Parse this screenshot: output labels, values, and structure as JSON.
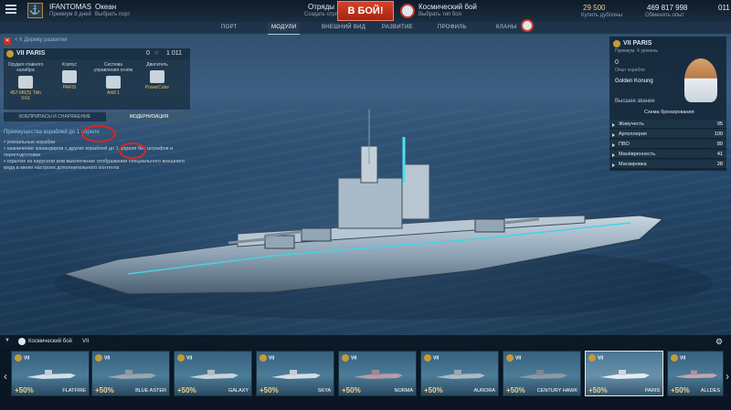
{
  "topbar": {
    "username": "IFANTOMAS",
    "user_sub": "Премиум 8 дней",
    "mode": "Океан",
    "mode_sub": "Выбрать порт",
    "squads": "Отряды",
    "squads_sub": "Создать отряд",
    "battle_button": "В БОЙ!",
    "battle_type": "Космический бой",
    "battle_type_sub": "Выбрать тип боя",
    "credits": "29 500",
    "credits_sub": "Купить дублоны",
    "silver": "469 817 998",
    "silver_sub": "Обменять опыт",
    "flags": "011"
  },
  "nav": {
    "tabs": [
      {
        "label": "ПОРТ",
        "active": false
      },
      {
        "label": "МОДУЛИ",
        "active": true
      },
      {
        "label": "ВНЕШНИЙ ВИД",
        "active": false
      },
      {
        "label": "РАЗВИТИЕ",
        "active": false
      },
      {
        "label": "ПРОФИЛЬ",
        "active": false
      },
      {
        "label": "КЛАНЫ",
        "active": false
      }
    ]
  },
  "left_panel": {
    "back_link": "< К Дереву развития",
    "ship_name": "VII PARIS",
    "ship_xp": "0",
    "ship_free": "1 011",
    "modules": [
      {
        "title": "Орудия главного калибра",
        "value": "457-МК(5) Tikh XXX"
      },
      {
        "title": "Корпус",
        "value": "PARIS"
      },
      {
        "title": "Система управления огнём",
        "value": "Аrtill 1"
      },
      {
        "title": "Двигатель",
        "value": "PowerCube"
      }
    ],
    "subtabs": [
      "БОЕПРИПАСЫ И СНАРЯЖЕНИЕ",
      "МОДЕРНИЗАЦИЯ"
    ],
    "notes_head": "Преимущества кораблей до 1 апреля",
    "notes": [
      "• уникальные корабли",
      "• назначение командиров с других кораблей до 1 апреля без штрафов и переподготовки",
      "• скрытие из карусели или выключение отображения специального внешнего вида в меню настроек дополнительного контента"
    ]
  },
  "right_panel": {
    "ship_name": "VII PARIS",
    "ship_sub": "Премиум. 4 уровень",
    "xp_value": "0",
    "xp_label": "Опыт корабля",
    "commander_name": "Golden Konung",
    "rank_label": "Высшее звание",
    "armor_label": "Схема бронирования",
    "stats": [
      {
        "label": "Живучесть",
        "value": "95"
      },
      {
        "label": "Артиллерия",
        "value": "100"
      },
      {
        "label": "ПВО",
        "value": "89"
      },
      {
        "label": "Манёвренность",
        "value": "41"
      },
      {
        "label": "Маскировка",
        "value": "28"
      }
    ]
  },
  "carousel": {
    "filter_label": "Космический бой",
    "tier_label": "VII",
    "ships": [
      {
        "tier": "VII",
        "bonus": "+50%",
        "name": "FLATFIRE",
        "selected": false
      },
      {
        "tier": "VII",
        "bonus": "+50%",
        "name": "BLUE ASTER",
        "selected": false
      },
      {
        "tier": "VII",
        "bonus": "+50%",
        "name": "GALAXY",
        "selected": false
      },
      {
        "tier": "VII",
        "bonus": "+50%",
        "name": "SKYA",
        "selected": false
      },
      {
        "tier": "VII",
        "bonus": "+50%",
        "name": "NORMA",
        "selected": false
      },
      {
        "tier": "VII",
        "bonus": "+50%",
        "name": "AURORA",
        "selected": false
      },
      {
        "tier": "VII",
        "bonus": "+50%",
        "name": "CENTURY HAWK",
        "selected": false
      },
      {
        "tier": "VII",
        "bonus": "+50%",
        "name": "PARIS",
        "selected": true
      },
      {
        "tier": "VII",
        "bonus": "+50%",
        "name": "ALLDES",
        "selected": false
      }
    ]
  }
}
